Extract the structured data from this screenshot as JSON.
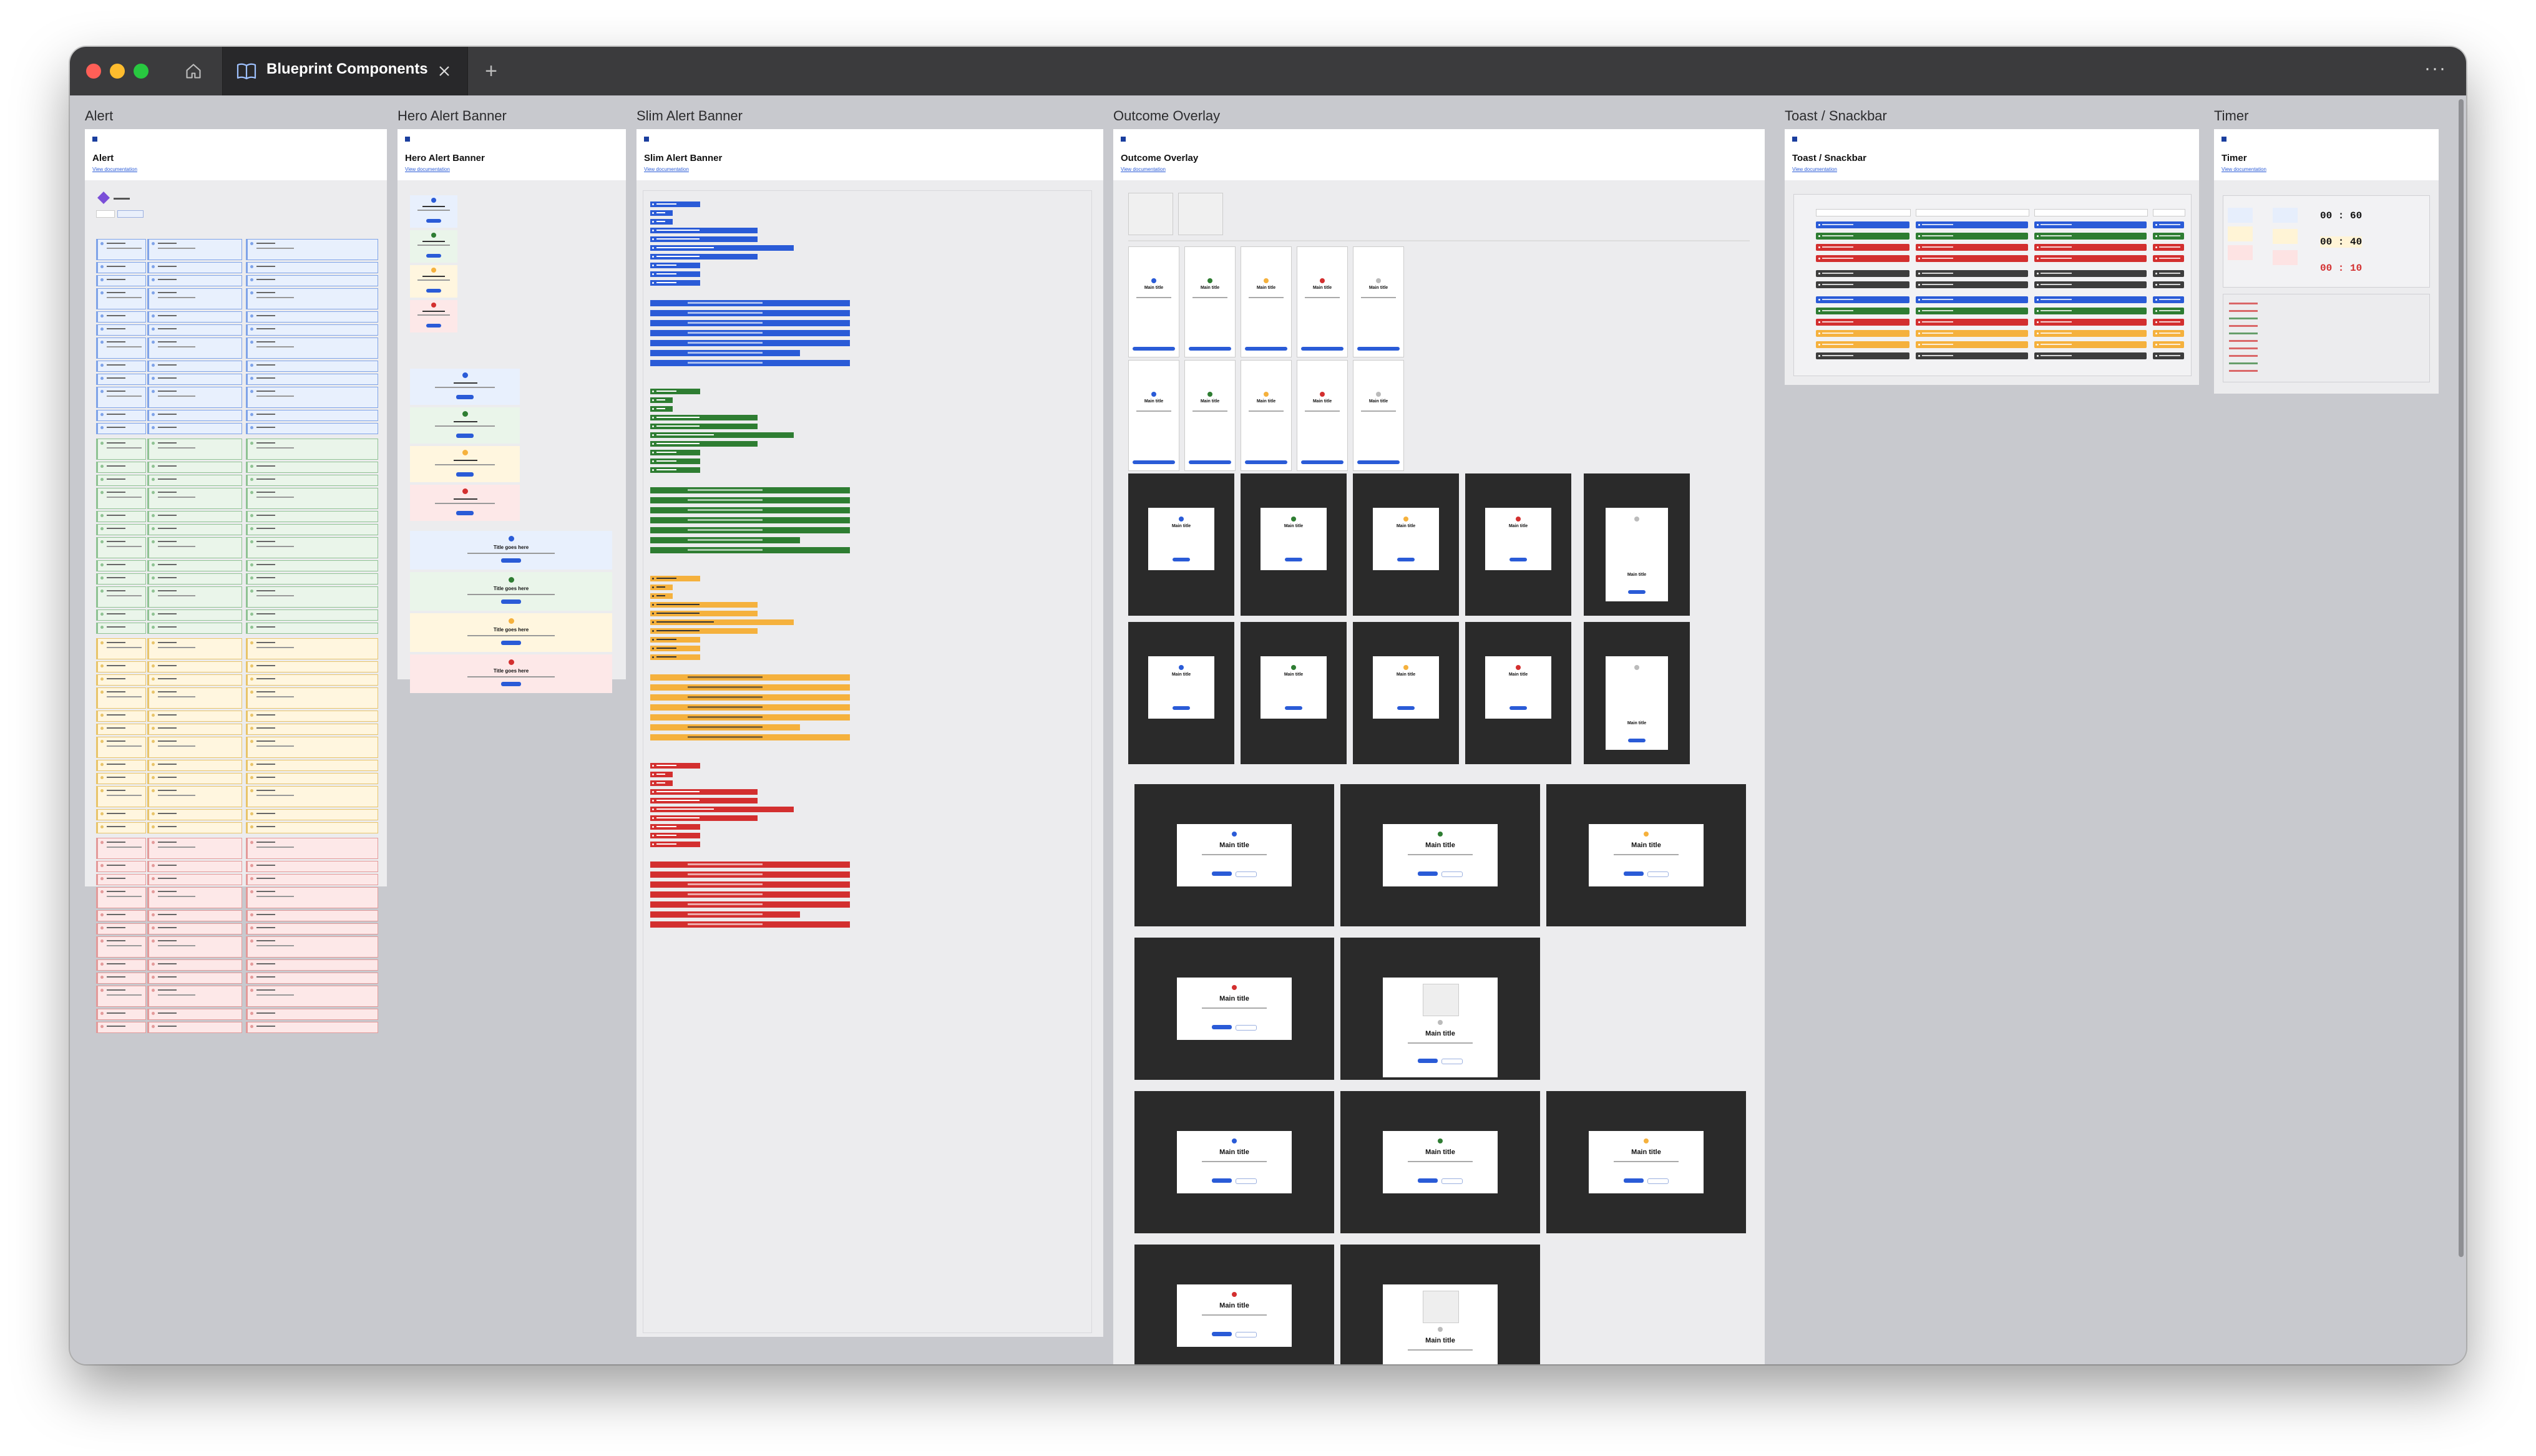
{
  "window": {
    "tab_title": "Blueprint Components",
    "new_tab_symbol": "+",
    "more_symbol": "···"
  },
  "icons": {
    "home": "home-icon",
    "book": "book-icon",
    "close": "close-icon"
  },
  "colors": {
    "info": "#2a5bd7",
    "success": "#2e7d32",
    "warning": "#f5b13d",
    "danger": "#d32f2f",
    "neutral": "#3d3d3d"
  },
  "frames": {
    "alert": {
      "label": "Alert",
      "title": "Alert",
      "doc_link": "View documentation"
    },
    "hero": {
      "label": "Hero Alert Banner",
      "title": "Hero Alert Banner",
      "doc_link": "View documentation",
      "card_title": "Title goes here"
    },
    "slim": {
      "label": "Slim Alert Banner",
      "title": "Slim Alert Banner",
      "doc_link": "View documentation"
    },
    "outcome": {
      "label": "Outcome Overlay",
      "title": "Outcome Overlay",
      "doc_link": "View documentation",
      "main_title": "Main title"
    },
    "toast": {
      "label": "Toast / Snackbar",
      "title": "Toast / Snackbar",
      "doc_link": "View documentation"
    },
    "timer": {
      "label": "Timer",
      "title": "Timer",
      "doc_link": "View documentation",
      "values": [
        "00 : 60",
        "00 : 40",
        "00 : 10"
      ]
    }
  }
}
